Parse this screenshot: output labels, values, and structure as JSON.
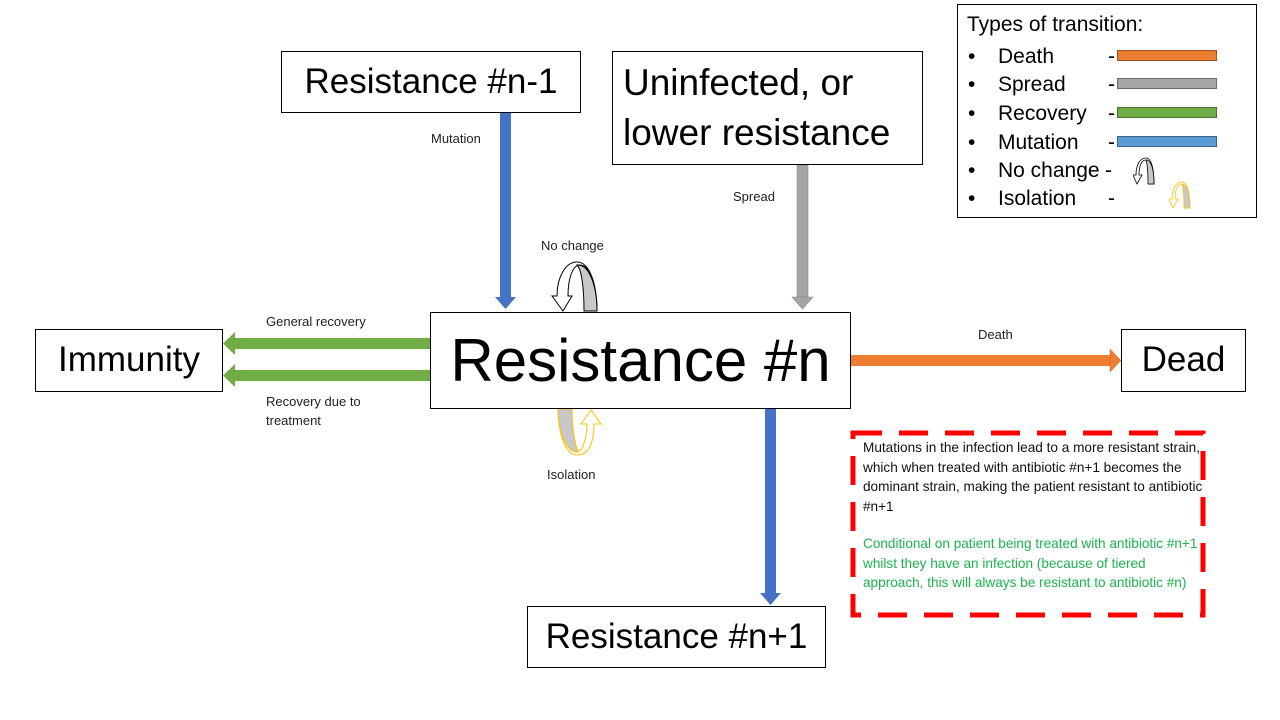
{
  "nodes": {
    "center": "Resistance #n",
    "prev": "Resistance #n-1",
    "source": "Uninfected, or\nlower resistance",
    "source_line1": "Uninfected, or",
    "source_line2": "lower resistance",
    "immunity": "Immunity",
    "dead": "Dead",
    "next": "Resistance #n+1"
  },
  "edges": {
    "mutation_in": "Mutation",
    "spread": "Spread",
    "no_change": "No change",
    "general_recovery": "General recovery",
    "treatment_recovery_line1": "Recovery due to",
    "treatment_recovery_line2": "treatment",
    "death": "Death",
    "isolation": "Isolation"
  },
  "legend": {
    "title": "Types of transition:",
    "items": [
      {
        "label": "Death",
        "kind": "bar",
        "color": "#ed7d31"
      },
      {
        "label": "Spread",
        "kind": "bar",
        "color": "#a5a5a5"
      },
      {
        "label": "Recovery",
        "kind": "bar",
        "color": "#70ad47"
      },
      {
        "label": "Mutation",
        "kind": "bar",
        "color": "#5b9bd5"
      },
      {
        "label": "No change",
        "kind": "loop",
        "color": "#000000"
      },
      {
        "label": "Isolation",
        "kind": "loop",
        "color": "#ffc000"
      }
    ],
    "bullet": "•",
    "dash": "-"
  },
  "note": {
    "main": "Mutations in the infection lead to a more resistant strain, which when treated with antibiotic #n+1 becomes the dominant strain, making the patient resistant to antibiotic #n+1",
    "condition": "Conditional on patient being treated with antibiotic #n+1 whilst they have an infection (because of tiered approach, this will always be resistant to antibiotic #n)",
    "border_color": "#ff0000"
  },
  "colors": {
    "mutation": "#4472c4",
    "spread": "#a5a5a5",
    "recovery": "#70ad47",
    "death": "#ed7d31",
    "isolation": "#ffc000"
  }
}
